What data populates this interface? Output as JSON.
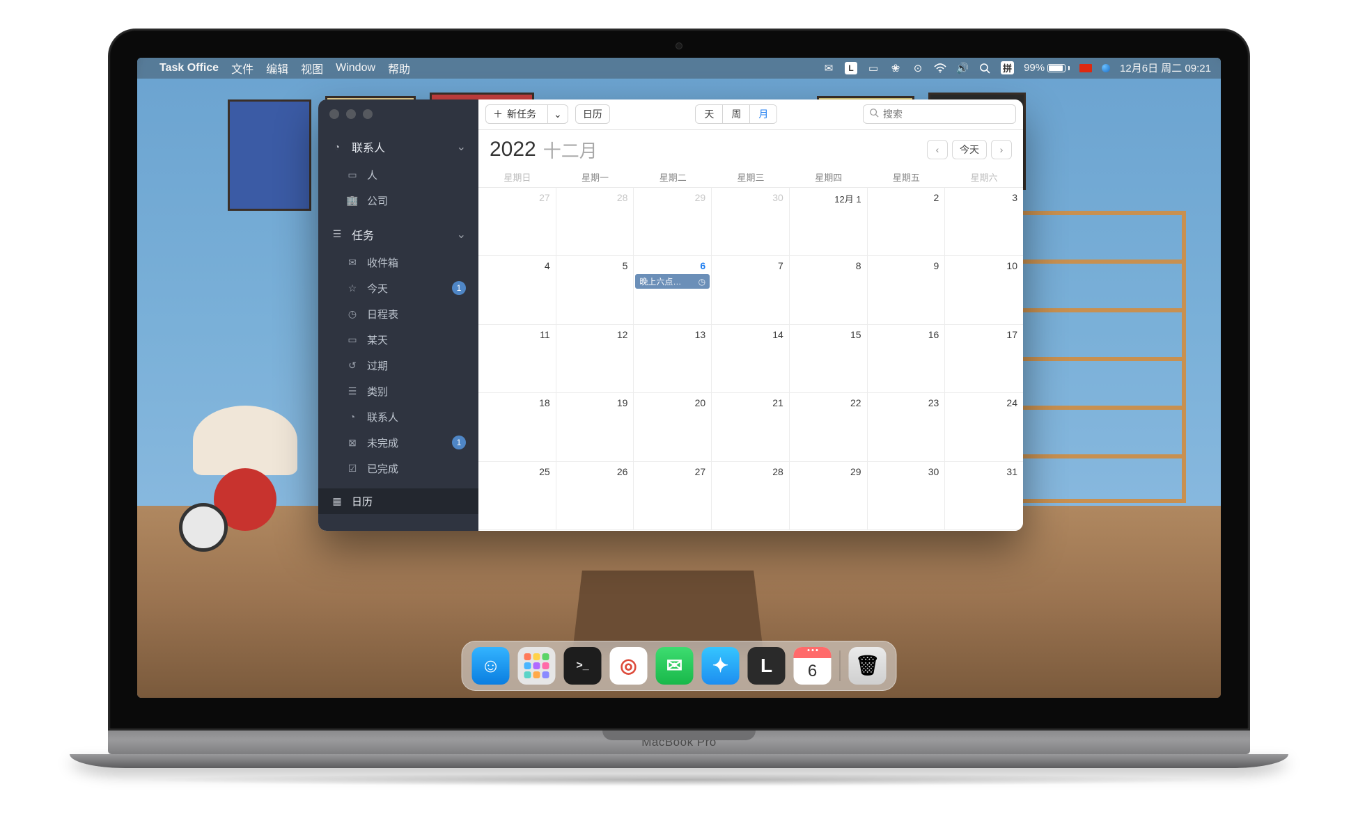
{
  "menubar": {
    "app": "Task Office",
    "items": [
      "文件",
      "编辑",
      "视图",
      "Window",
      "帮助"
    ],
    "battery": "99%",
    "ime": "拼",
    "datetime": "12月6日 周二  09:21"
  },
  "sidebar": {
    "contacts": {
      "label": "联系人",
      "items": [
        {
          "icon": "person",
          "label": "人"
        },
        {
          "icon": "building",
          "label": "公司"
        }
      ]
    },
    "tasks": {
      "label": "任务",
      "items": [
        {
          "icon": "inbox",
          "label": "收件箱",
          "badge": null
        },
        {
          "icon": "star",
          "label": "今天",
          "badge": "1"
        },
        {
          "icon": "clock",
          "label": "日程表",
          "badge": null
        },
        {
          "icon": "calendar-day",
          "label": "某天",
          "badge": null
        },
        {
          "icon": "history",
          "label": "过期",
          "badge": null
        },
        {
          "icon": "tag",
          "label": "类别",
          "badge": null
        },
        {
          "icon": "person",
          "label": "联系人",
          "badge": null
        },
        {
          "icon": "x-square",
          "label": "未完成",
          "badge": "1"
        },
        {
          "icon": "check-square",
          "label": "已完成",
          "badge": null
        }
      ]
    },
    "calendar": {
      "icon": "grid",
      "label": "日历",
      "active": true
    }
  },
  "toolbar": {
    "newtask": "新任务",
    "calendar_btn": "日历",
    "views": {
      "day": "天",
      "week": "周",
      "month": "月",
      "active": "month"
    },
    "search_placeholder": "搜索"
  },
  "calendar": {
    "year": "2022",
    "month": "十二月",
    "today_btn": "今天",
    "prev": "‹",
    "next": "›",
    "weekday": [
      "星期日",
      "星期一",
      "星期二",
      "星期三",
      "星期四",
      "星期五",
      "星期六"
    ],
    "first_label": "12月 1",
    "today_day": 6,
    "event": {
      "title": "晚上六点…"
    },
    "weeks": [
      [
        {
          "n": 27,
          "other": true
        },
        {
          "n": 28,
          "other": true
        },
        {
          "n": 29,
          "other": true
        },
        {
          "n": 30,
          "other": true
        },
        {
          "n": 1,
          "first": true
        },
        {
          "n": 2
        },
        {
          "n": 3
        }
      ],
      [
        {
          "n": 4
        },
        {
          "n": 5
        },
        {
          "n": 6,
          "today": true,
          "event": true
        },
        {
          "n": 7
        },
        {
          "n": 8
        },
        {
          "n": 9
        },
        {
          "n": 10
        }
      ],
      [
        {
          "n": 11
        },
        {
          "n": 12
        },
        {
          "n": 13
        },
        {
          "n": 14
        },
        {
          "n": 15
        },
        {
          "n": 16
        },
        {
          "n": 17
        }
      ],
      [
        {
          "n": 18
        },
        {
          "n": 19
        },
        {
          "n": 20
        },
        {
          "n": 21
        },
        {
          "n": 22
        },
        {
          "n": 23
        },
        {
          "n": 24
        }
      ],
      [
        {
          "n": 25
        },
        {
          "n": 26
        },
        {
          "n": 27
        },
        {
          "n": 28
        },
        {
          "n": 29
        },
        {
          "n": 30
        },
        {
          "n": 31
        }
      ]
    ]
  },
  "dock": {
    "apps": [
      {
        "name": "finder",
        "bg": "linear-gradient(180deg,#33b4ff,#0a7ee0)",
        "glyph": "☺",
        "color": "#fff"
      },
      {
        "name": "launchpad",
        "bg": "#e6e6e6",
        "glyph": "⊞",
        "color": "#888"
      },
      {
        "name": "terminal",
        "bg": "#1d1d1d",
        "glyph": ">_",
        "color": "#eee"
      },
      {
        "name": "chrome",
        "bg": "#fff",
        "glyph": "◎",
        "color": "#dd4a3a"
      },
      {
        "name": "wechat",
        "bg": "linear-gradient(180deg,#3ddc70,#19b84a)",
        "glyph": "✉",
        "color": "#fff"
      },
      {
        "name": "safari",
        "bg": "linear-gradient(180deg,#35c5ff,#1d8ef0)",
        "glyph": "✦",
        "color": "#fff"
      },
      {
        "name": "l-app",
        "bg": "#2a2a2a",
        "glyph": "L",
        "color": "#fff"
      },
      {
        "name": "calendar",
        "bg": "#fff",
        "glyph": "6",
        "color": "#e03030"
      }
    ],
    "trash": {
      "glyph": "🗑"
    }
  },
  "laptop_label": "MacBook Pro"
}
